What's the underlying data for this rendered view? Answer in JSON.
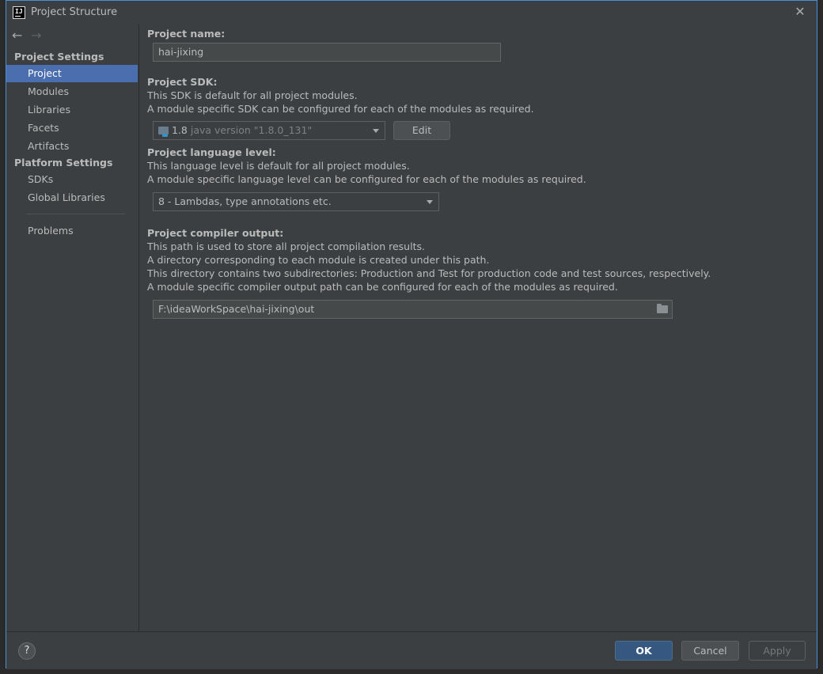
{
  "window": {
    "title": "Project Structure",
    "app_icon_text": "IJ"
  },
  "nav": {
    "back": "←",
    "forward": "→"
  },
  "sidebar": {
    "project_settings_header": "Project Settings",
    "project_settings_items": [
      {
        "label": "Project",
        "selected": true
      },
      {
        "label": "Modules"
      },
      {
        "label": "Libraries"
      },
      {
        "label": "Facets"
      },
      {
        "label": "Artifacts"
      }
    ],
    "platform_settings_header": "Platform Settings",
    "platform_settings_items": [
      {
        "label": "SDKs"
      },
      {
        "label": "Global Libraries"
      }
    ],
    "problems_label": "Problems",
    "selected_color": "#4b6eaf"
  },
  "main": {
    "project_name": {
      "label": "Project name:",
      "value": "hai-jixing"
    },
    "project_sdk": {
      "label": "Project SDK:",
      "desc1": "This SDK is default for all project modules.",
      "desc2": "A module specific SDK can be configured for each of the modules as required.",
      "version": "1.8",
      "detail": "java version \"1.8.0_131\"",
      "edit_label": "Edit"
    },
    "language_level": {
      "label": "Project language level:",
      "desc1": "This language level is default for all project modules.",
      "desc2": "A module specific language level can be configured for each of the modules as required.",
      "value": "8 - Lambdas, type annotations etc."
    },
    "compiler_output": {
      "label": "Project compiler output:",
      "desc1": "This path is used to store all project compilation results.",
      "desc2": "A directory corresponding to each module is created under this path.",
      "desc3": "This directory contains two subdirectories: Production and Test for production code and test sources, respectively.",
      "desc4": "A module specific compiler output path can be configured for each of the modules as required.",
      "value": "F:\\ideaWorkSpace\\hai-jixing\\out"
    }
  },
  "footer": {
    "help": "?",
    "ok": "OK",
    "cancel": "Cancel",
    "apply": "Apply"
  },
  "colors": {
    "dialog_bg": "#3c3f41",
    "accent_border": "#4a90d9",
    "ok_bg": "#365880"
  }
}
